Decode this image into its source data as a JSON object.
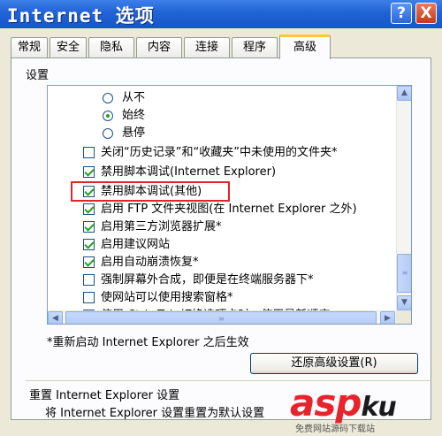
{
  "window": {
    "title": "Internet 选项",
    "help_label": "?",
    "close_label": "X"
  },
  "tabs": [
    {
      "label": "常规"
    },
    {
      "label": "安全"
    },
    {
      "label": "隐私"
    },
    {
      "label": "内容"
    },
    {
      "label": "连接"
    },
    {
      "label": "程序"
    },
    {
      "label": "高级",
      "active": true
    }
  ],
  "settings": {
    "group_label": "设置",
    "items": [
      {
        "type": "radio",
        "label": "从不",
        "checked": false
      },
      {
        "type": "radio",
        "label": "始终",
        "checked": true
      },
      {
        "type": "radio",
        "label": "悬停",
        "checked": false
      },
      {
        "type": "checkbox",
        "label": "关闭“历史记录”和“收藏夹”中未使用的文件夹*",
        "checked": false
      },
      {
        "type": "checkbox",
        "label": "禁用脚本调试(Internet Explorer)",
        "checked": true
      },
      {
        "type": "checkbox",
        "label": "禁用脚本调试(其他)",
        "checked": true,
        "highlighted": true
      },
      {
        "type": "checkbox",
        "label": "启用 FTP 文件夹视图(在 Internet Explorer 之外)",
        "checked": true
      },
      {
        "type": "checkbox",
        "label": "启用第三方浏览器扩展*",
        "checked": true
      },
      {
        "type": "checkbox",
        "label": "启用建议网站",
        "checked": true
      },
      {
        "type": "checkbox",
        "label": "启用自动崩溃恢复*",
        "checked": true
      },
      {
        "type": "checkbox",
        "label": "强制屏幕外合成，即便是在终端服务器下*",
        "checked": false
      },
      {
        "type": "checkbox",
        "label": "使网站可以使用搜索窗格*",
        "checked": false
      },
      {
        "type": "checkbox",
        "label": "使用 Ctrl+Tab 切换选项卡时，使用最新顺序",
        "checked": false
      }
    ],
    "scroll": {
      "up": "▲",
      "down": "▼",
      "left": "◀",
      "right": "▶",
      "grip": "≡"
    }
  },
  "restart_note": "*重新启动 Internet Explorer 之后生效",
  "restore_button": "还原高级设置(R)",
  "reset": {
    "title": "重置 Internet Explorer 设置",
    "description": "将 Internet Explorer 设置重置为默认设置"
  },
  "watermark": {
    "logo_red": "asp",
    "logo_dark": "ku",
    "tagline": "免费网站源码下载站"
  },
  "colors": {
    "titlebar": "#2063d6",
    "dialog_bg": "#ece9d8",
    "check_green": "#21a121",
    "highlight_red": "#e0242a",
    "active_tab_accent": "#ffc83c"
  }
}
